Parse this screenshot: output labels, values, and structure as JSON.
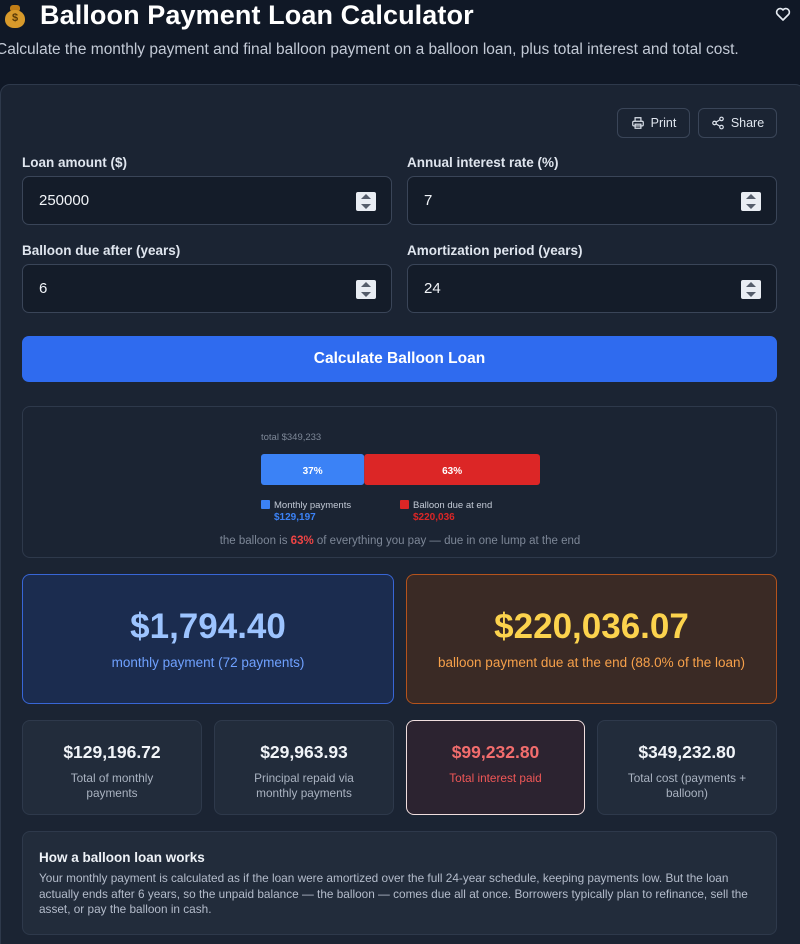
{
  "header": {
    "title": "Balloon Payment Loan Calculator",
    "subtitle": "Calculate the monthly payment and final balloon payment on a balloon loan, plus total interest and total cost."
  },
  "toolbar": {
    "print_label": "Print",
    "share_label": "Share"
  },
  "form": {
    "loan_amount": {
      "label": "Loan amount ($)",
      "value": "250000"
    },
    "interest_rate": {
      "label": "Annual interest rate (%)",
      "value": "7"
    },
    "balloon_due": {
      "label": "Balloon due after (years)",
      "value": "6"
    },
    "amortization": {
      "label": "Amortization period (years)",
      "value": "24"
    },
    "calculate_label": "Calculate Balloon Loan"
  },
  "chart_data": {
    "type": "bar",
    "title": "total $349,233",
    "series": [
      {
        "name": "Monthly payments",
        "value": 129197,
        "value_label": "$129,197",
        "percent_label": "37%",
        "color": "#3b82f6"
      },
      {
        "name": "Balloon due at end",
        "value": 220036,
        "value_label": "$220,036",
        "percent_label": "63%",
        "color": "#dc2626"
      }
    ],
    "caption": {
      "pre": "the balloon is ",
      "highlight": "63%",
      "post": " of everything you pay — due in one lump at the end"
    }
  },
  "results": {
    "monthly": {
      "value": "$1,794.40",
      "desc": "monthly payment (72 payments)"
    },
    "balloon": {
      "value": "$220,036.07",
      "desc": "balloon payment due at the end (88.0% of the loan)"
    },
    "stats": [
      {
        "value": "$129,196.72",
        "desc": "Total of monthly payments"
      },
      {
        "value": "$29,963.93",
        "desc": "Principal repaid via monthly payments"
      },
      {
        "value": "$99,232.80",
        "desc": "Total interest paid"
      },
      {
        "value": "$349,232.80",
        "desc": "Total cost (payments + balloon)"
      }
    ]
  },
  "info": {
    "title": "How a balloon loan works",
    "text": "Your monthly payment is calculated as if the loan were amortized over the full 24-year schedule, keeping payments low. But the loan actually ends after 6 years, so the unpaid balance — the balloon — comes due all at once. Borrowers typically plan to refinance, sell the asset, or pay the balloon in cash."
  },
  "colors": {
    "accent": "#2f6bef",
    "monthly_blue": "#9dc4ff",
    "balloon_yellow": "#fcd34d",
    "interest_red": "#f26d6d"
  },
  "icons": [
    "money-bag-icon",
    "heart-icon",
    "printer-icon",
    "share-icon",
    "stepper-icon"
  ]
}
